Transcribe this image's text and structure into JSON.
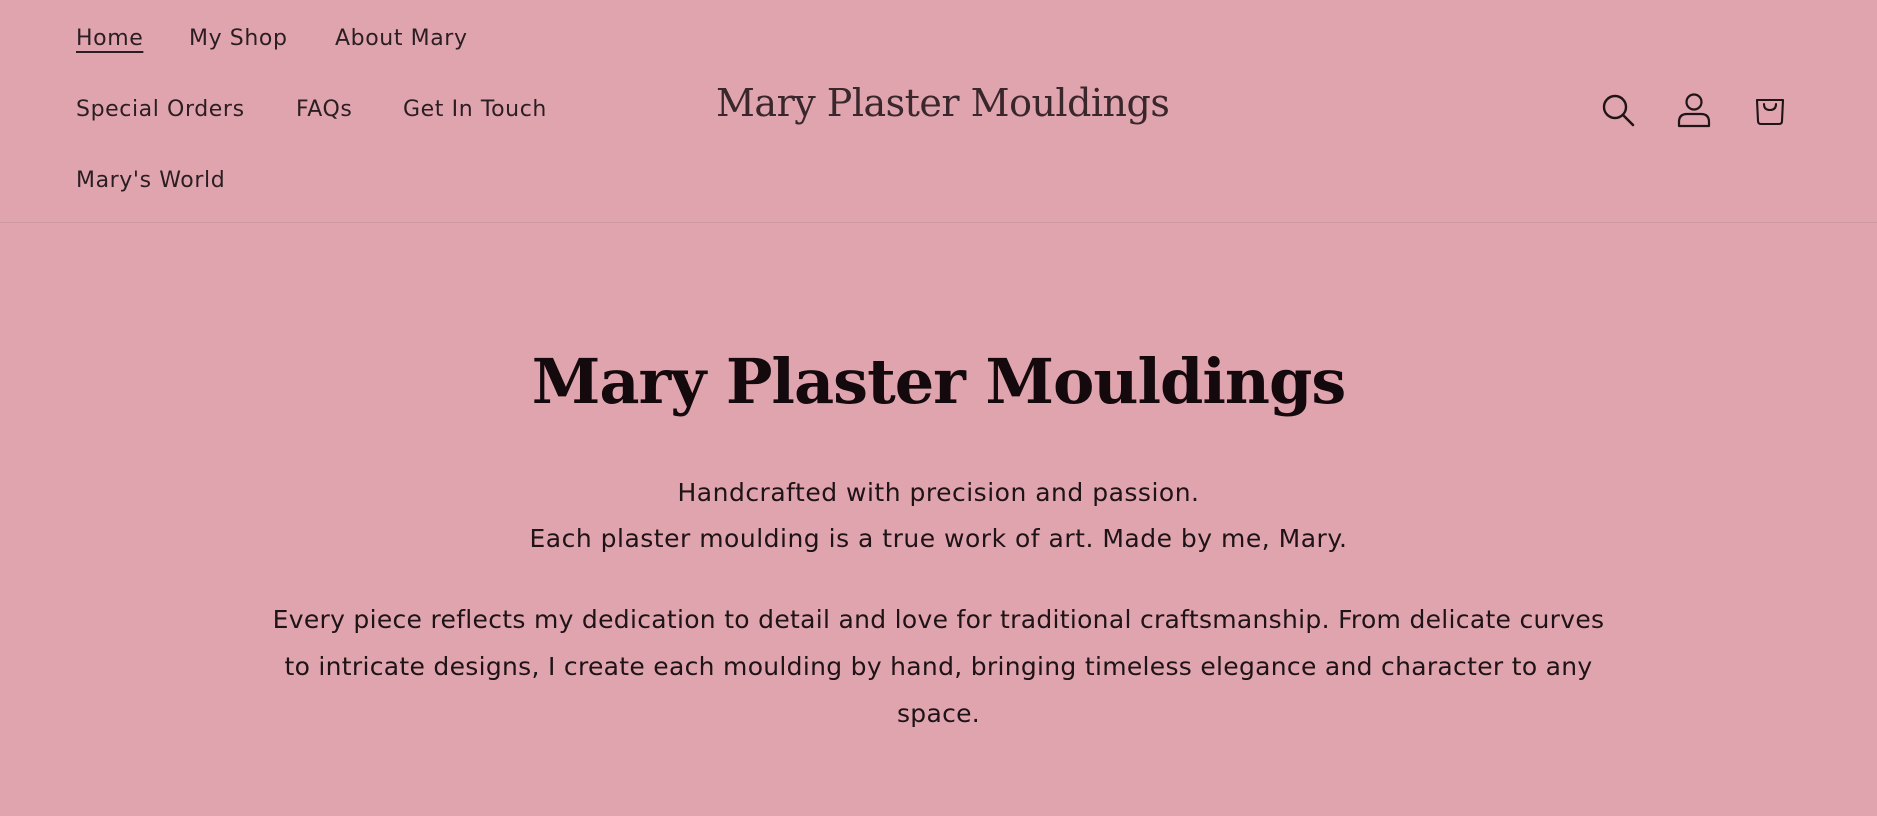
{
  "header": {
    "nav": [
      {
        "label": "Home",
        "active": true
      },
      {
        "label": "My Shop",
        "active": false
      },
      {
        "label": "About Mary",
        "active": false
      },
      {
        "label": "Special Orders",
        "active": false
      },
      {
        "label": "FAQs",
        "active": false
      },
      {
        "label": "Get In Touch",
        "active": false
      },
      {
        "label": "Mary's World",
        "active": false
      }
    ],
    "brand": "Mary Plaster Mouldings",
    "icons": [
      "search-icon",
      "account-icon",
      "cart-icon"
    ]
  },
  "hero": {
    "title": "Mary Plaster Mouldings",
    "line1": "Handcrafted with precision and passion.",
    "line2": "Each plaster moulding is a true work of art. Made by me, Mary.",
    "paragraph": "Every piece reflects my dedication to detail and love for traditional craftsmanship. From delicate curves to intricate designs, I create each moulding by hand, bringing timeless elegance and character to any space."
  },
  "colors": {
    "background": "#e0a4ae",
    "text": "#1f1416",
    "brand_text": "#3a272c"
  }
}
